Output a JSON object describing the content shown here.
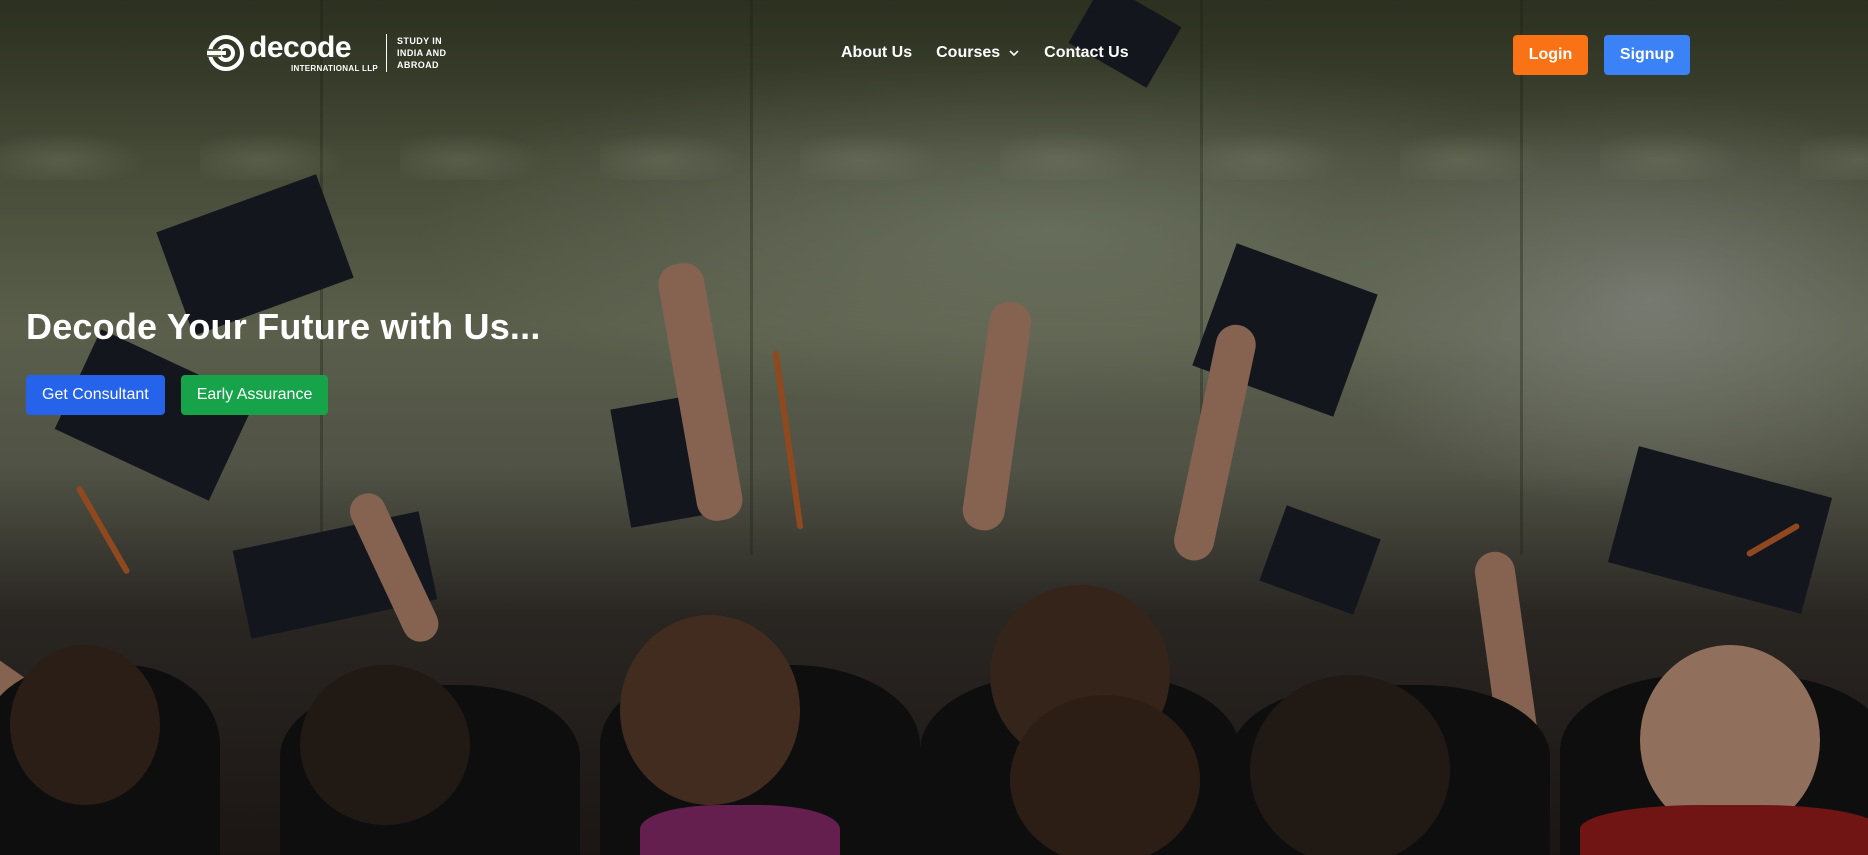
{
  "brand": {
    "name": "decode",
    "sub": "INTERNATIONAL LLP",
    "tagline": [
      "STUDY IN",
      "INDIA AND",
      "ABROAD"
    ]
  },
  "nav": {
    "items": [
      {
        "label": "About Us"
      },
      {
        "label": "Courses",
        "icon": "chevron-down-icon"
      },
      {
        "label": "Contact Us"
      }
    ],
    "login_label": "Login",
    "signup_label": "Signup"
  },
  "hero": {
    "title": "Decode Your Future with Us...",
    "primary_cta": "Get Consultant",
    "secondary_cta": "Early Assurance",
    "background": "graduation-caps-photo"
  },
  "colors": {
    "login": "#f97316",
    "signup": "#3b82f6",
    "consultant": "#2563eb",
    "assurance": "#16a34a"
  }
}
